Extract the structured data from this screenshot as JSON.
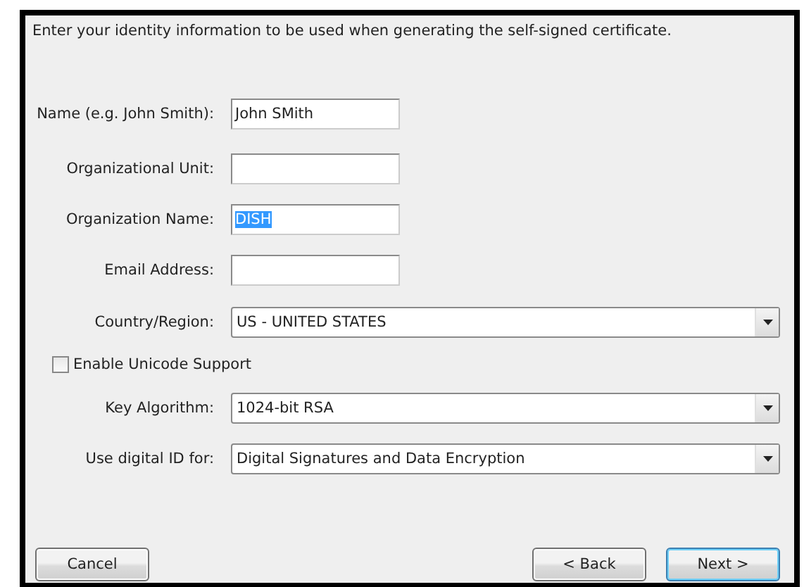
{
  "intro": "Enter your identity information to be used when generating the self-signed certificate.",
  "fields": [
    {
      "kind": "text",
      "label": "Name (e.g. John Smith):",
      "value": "John SMith"
    },
    {
      "kind": "text",
      "label": "Organizational Unit:"
    },
    {
      "kind": "text",
      "label": "Organization Name:",
      "value": "DISH",
      "text_selected": true
    },
    {
      "kind": "text",
      "label": "Email Address:"
    },
    {
      "kind": "select",
      "label": "Country/Region:",
      "value": "US - UNITED STATES"
    },
    {
      "kind": "checkbox",
      "label": "Enable Unicode Support",
      "checked": false
    },
    {
      "kind": "select",
      "label": "Key Algorithm:",
      "value": "1024-bit RSA"
    },
    {
      "kind": "select",
      "label": "Use digital ID for:",
      "value": "Digital Signatures and Data Encryption"
    }
  ],
  "buttons": [
    {
      "label": "Cancel",
      "default": false
    },
    {
      "label": "< Back",
      "default": false
    },
    {
      "label": "Next >",
      "default": true
    }
  ]
}
